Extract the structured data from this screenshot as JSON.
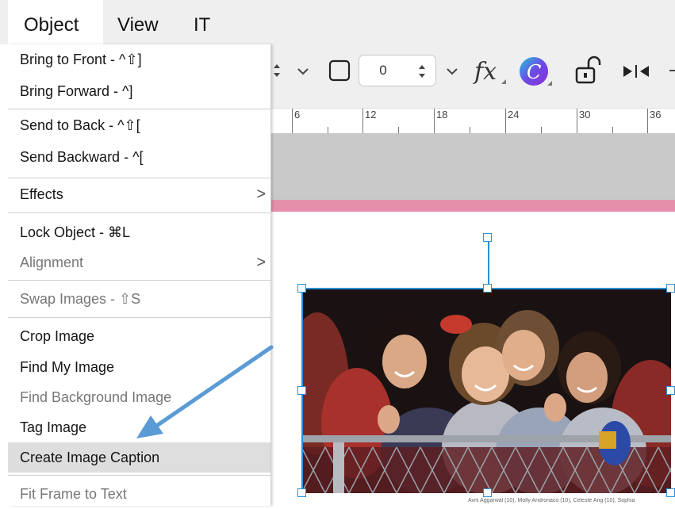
{
  "menubar": {
    "items": [
      "Object",
      "View",
      "IT"
    ]
  },
  "toolbar": {
    "stepper1_value": "0",
    "icons": [
      "caret-down-icon",
      "frame-icon",
      "stepper-icon",
      "fx-icon",
      "canva-icon",
      "unlock-icon",
      "flip-icon"
    ]
  },
  "ruler": {
    "labels": [
      "6",
      "12",
      "18",
      "24",
      "30",
      "36"
    ]
  },
  "menu": {
    "items": [
      "Bring to Front - ^⇧]",
      "Bring Forward - ^]",
      "Send to Back - ^⇧[",
      "Send Backward - ^[",
      "Effects",
      "Lock Object - ⌘L",
      "Alignment",
      "Swap Images - ⇧S",
      "Crop Image",
      "Find My Image",
      "Find Background Image",
      "Tag Image",
      "Create Image Caption",
      "Fit Frame to Text"
    ],
    "submenu_chevron": ">"
  },
  "caption_text": "Avni Aggarwal (10), Molly Andronaco (10), Celeste Ang (10), Sophia",
  "colors": {
    "accent": "#2c8fd8",
    "arrow": "#5b9bd5",
    "pink_band": "#e58fab"
  }
}
